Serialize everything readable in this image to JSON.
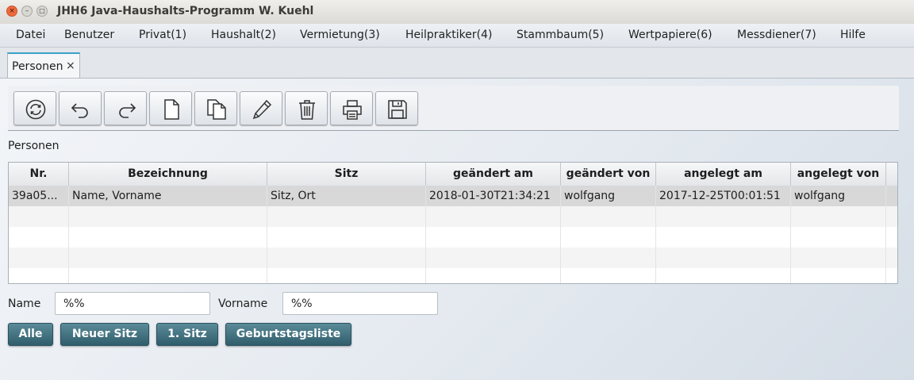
{
  "window": {
    "title": "JHH6 Java-Haushalts-Programm W. Kuehl",
    "close_glyph": "×",
    "min_glyph": "–",
    "max_glyph": "□"
  },
  "menu": [
    "Datei",
    "Benutzer",
    "Privat(1)",
    "Haushalt(2)",
    "Vermietung(3)",
    "Heilpraktiker(4)",
    "Stammbaum(5)",
    "Wertpapiere(6)",
    "Messdiener(7)",
    "Hilfe"
  ],
  "tab": {
    "label": "Personen",
    "close_glyph": "×"
  },
  "toolbar": {
    "buttons": [
      "refresh-icon",
      "undo-icon",
      "redo-icon",
      "new-document-icon",
      "copy-document-icon",
      "edit-pencil-icon",
      "delete-trash-icon",
      "print-icon",
      "save-icon"
    ]
  },
  "section_label": "Personen",
  "table": {
    "columns": [
      "Nr.",
      "Bezeichnung",
      "Sitz",
      "geändert am",
      "geändert von",
      "angelegt am",
      "angelegt von"
    ],
    "rows": [
      [
        "39a05...",
        "Name, Vorname",
        "Sitz, Ort",
        "2018-01-30T21:34:21",
        "wolfgang",
        "2017-12-25T00:01:51",
        "wolfgang"
      ]
    ]
  },
  "filter": {
    "name_label": "Name",
    "name_value": "%%",
    "vorname_label": "Vorname",
    "vorname_value": "%%"
  },
  "buttons": {
    "alle": "Alle",
    "neuer_sitz": "Neuer Sitz",
    "erster_sitz": "1. Sitz",
    "geburtstagsliste": "Geburtstagsliste"
  },
  "colors": {
    "accent_tab": "#3ca0c8",
    "button_dark": "#2f5d6b",
    "window_close": "#ef6a3b"
  }
}
